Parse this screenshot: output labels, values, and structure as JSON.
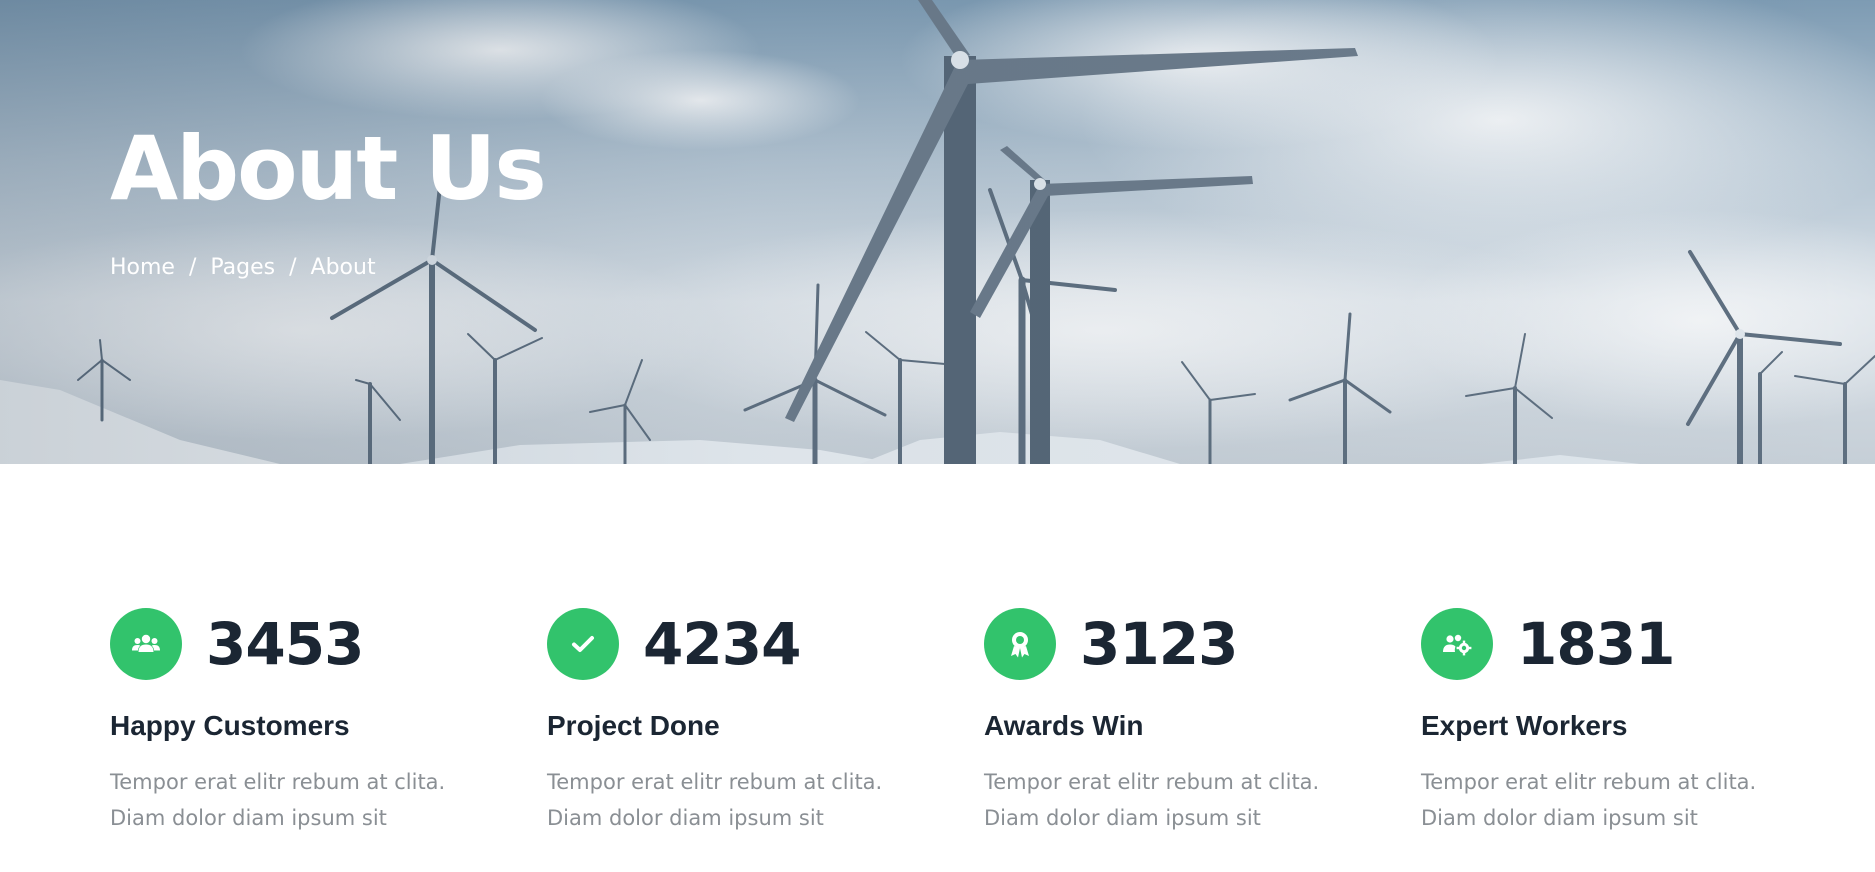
{
  "hero": {
    "title": "About Us",
    "breadcrumb": [
      "Home",
      "Pages",
      "About"
    ],
    "separator": "/"
  },
  "facts": [
    {
      "icon": "users-icon",
      "number": "3453",
      "title": "Happy Customers",
      "description": "Tempor erat elitr rebum at clita. Diam dolor diam ipsum sit"
    },
    {
      "icon": "check-icon",
      "number": "4234",
      "title": "Project Done",
      "description": "Tempor erat elitr rebum at clita. Diam dolor diam ipsum sit"
    },
    {
      "icon": "award-icon",
      "number": "3123",
      "title": "Awards Win",
      "description": "Tempor erat elitr rebum at clita. Diam dolor diam ipsum sit"
    },
    {
      "icon": "users-cog-icon",
      "number": "1831",
      "title": "Expert Workers",
      "description": "Tempor erat elitr rebum at clita. Diam dolor diam ipsum sit"
    }
  ],
  "colors": {
    "accent": "#32c36c",
    "heading": "#1b2633",
    "muted": "#8a8f94"
  }
}
